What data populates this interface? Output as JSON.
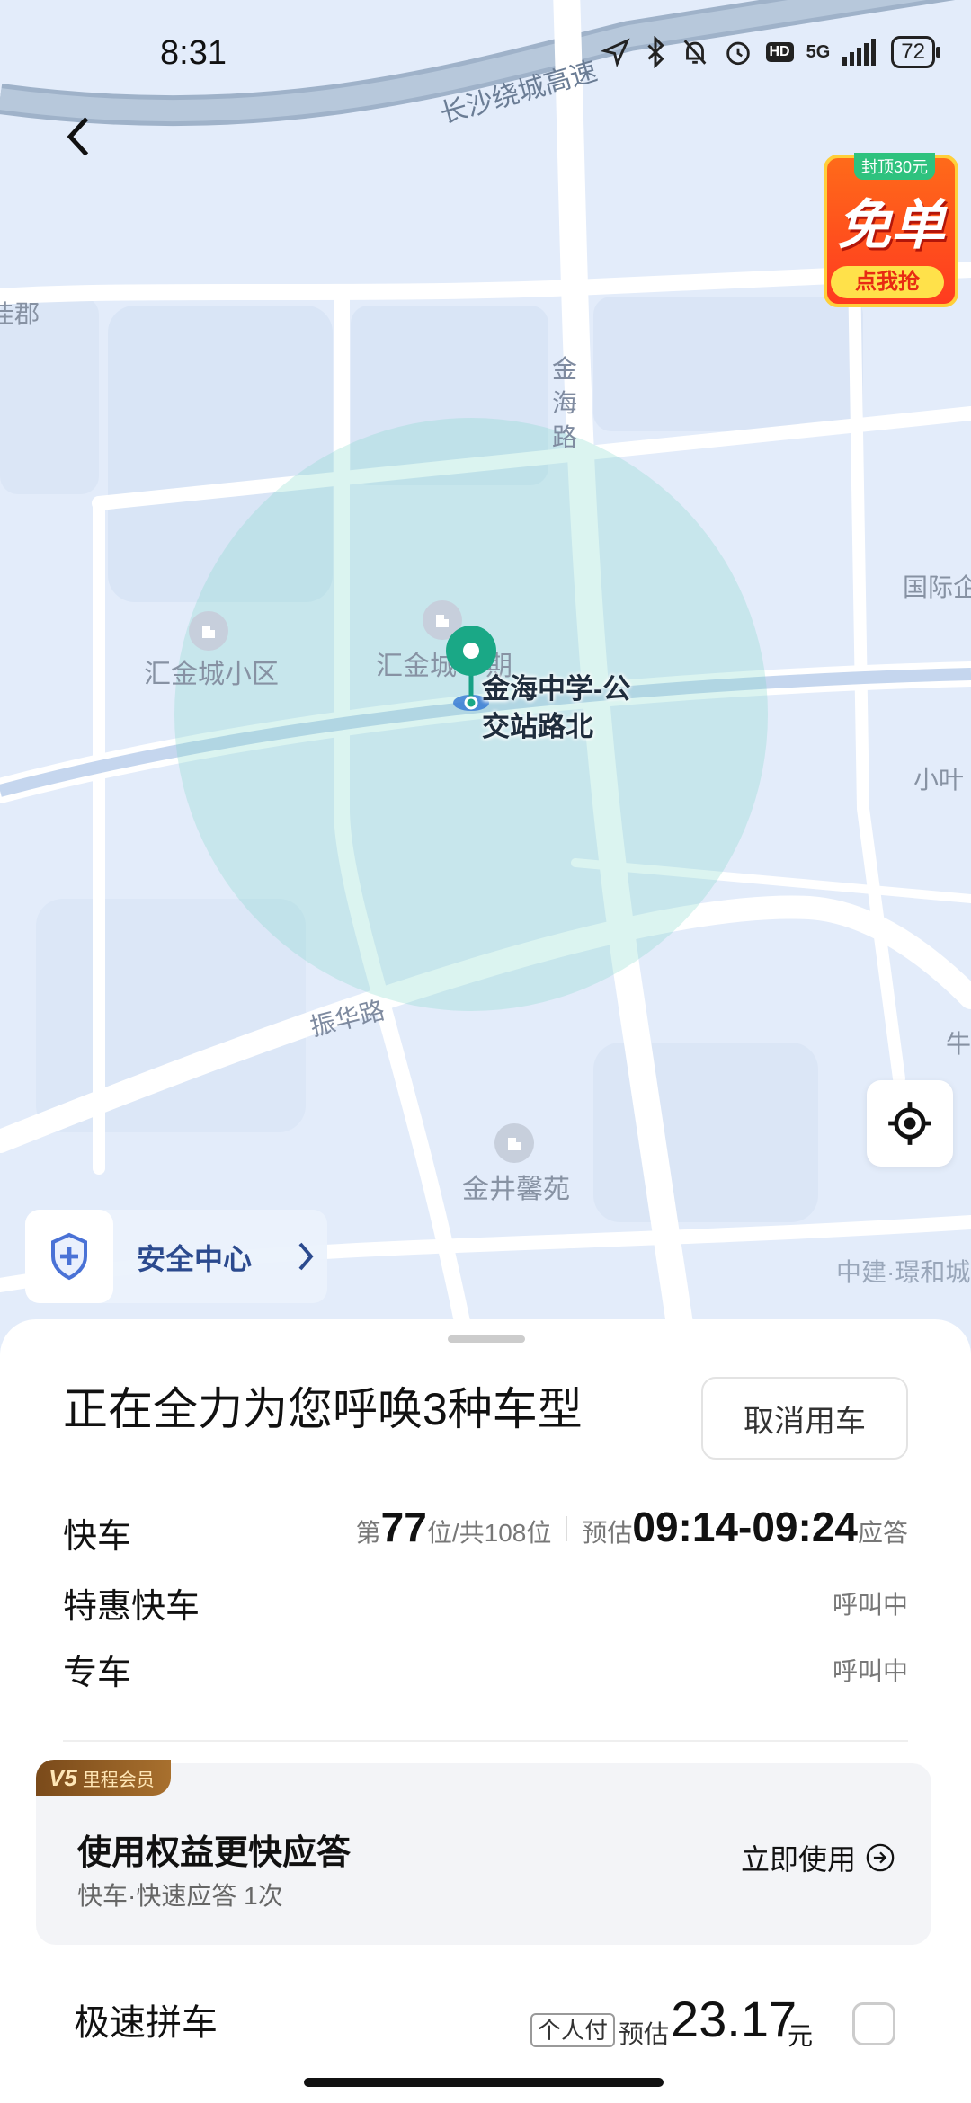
{
  "status_bar": {
    "time": "8:31",
    "network": "5G",
    "battery": "72"
  },
  "map": {
    "road_labels": {
      "ring_expressway": "长沙绕城高速",
      "jinhai_road": "金\n海\n路",
      "zhenhua_road": "振华路"
    },
    "poi_labels": {
      "huijincheng_xiaoqu": "汇金城小区",
      "huijincheng_partial": "汇金城",
      "huijincheng_partial_end": "期",
      "jinjing_xinyuan": "金井馨苑",
      "guoji_partial": "国际企",
      "xiaoye_partial": "小叶",
      "zhongjian": "中建·璟和城",
      "left_edge": "佳郡",
      "right_edge": "牛"
    },
    "pickup_label": "金海中学-公\n交站路北"
  },
  "promo": {
    "cap": "封顶30元",
    "big": "免单",
    "button": "点我抢"
  },
  "safety": {
    "label": "安全中心"
  },
  "sheet": {
    "heading": "正在全力为您呼唤3种车型",
    "cancel": "取消用车",
    "cars": [
      {
        "name": "快车",
        "prefix": "第",
        "rank": "77",
        "rank_suffix": "位/共108位",
        "est_label": "预估",
        "eta": "09:14-09:24",
        "eta_suffix": "应答"
      },
      {
        "name": "特惠快车",
        "status": "呼叫中"
      },
      {
        "name": "专车",
        "status": "呼叫中"
      }
    ],
    "member": {
      "badge_level": "V5",
      "badge_text": "里程会员",
      "title": "使用权益更快应答",
      "subtitle": "快车·快速应答 1次",
      "action": "立即使用"
    },
    "pool": {
      "name": "极速拼车",
      "tag": "个人付",
      "est_label": "预估",
      "price": "23.17",
      "unit": "元"
    }
  }
}
